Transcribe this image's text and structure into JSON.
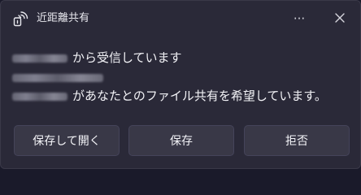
{
  "header": {
    "app_icon": "nearby-sharing-icon",
    "title": "近距離共有",
    "more_label": "···",
    "close_icon": "close-icon"
  },
  "message": {
    "line1_text": "から受信しています",
    "line3_text": "があなたとのファイル共有を希望しています。"
  },
  "actions": {
    "save_open_label": "保存して開く",
    "save_label": "保存",
    "decline_label": "拒否"
  },
  "colors": {
    "background": "#2a2938",
    "button": "#393847",
    "text": "#ffffff"
  }
}
